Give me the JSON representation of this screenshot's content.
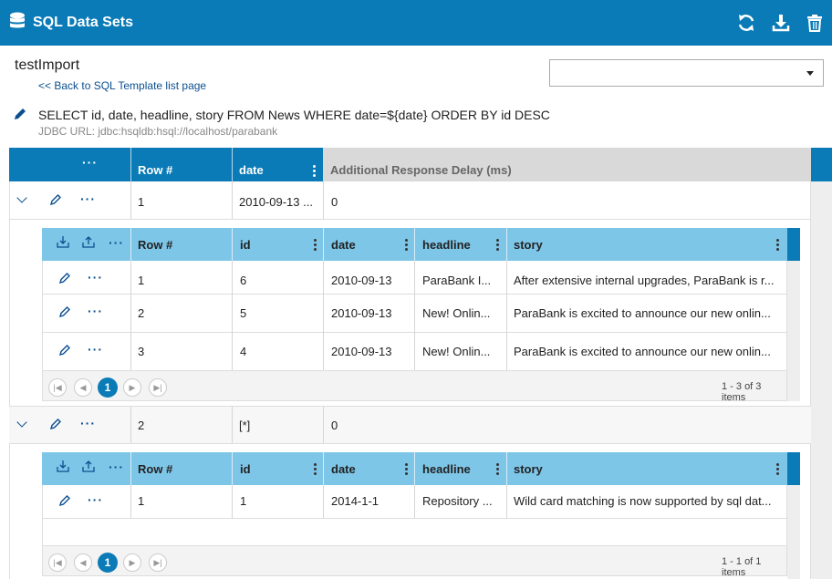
{
  "app": {
    "title": "SQL Data Sets"
  },
  "toolbar": {
    "refresh_icon": "refresh-icon",
    "download_icon": "download-icon",
    "delete_icon": "trash-icon"
  },
  "dataset": {
    "name": "testImport",
    "back_link": "<< Back to SQL Template list page",
    "select_value": "",
    "sql": "SELECT id, date, headline, story FROM News WHERE date=${date} ORDER BY id DESC",
    "jdbc": "JDBC URL: jdbc:hsqldb:hsql://localhost/parabank"
  },
  "outer_table": {
    "menu_label": "···",
    "columns": [
      "Row #",
      "date",
      "Additional Response Delay (ms)"
    ],
    "rows": [
      {
        "row": "1",
        "date": "2010-09-13 ...",
        "delay": "0"
      },
      {
        "row": "2",
        "date": "[*]",
        "delay": "0"
      }
    ]
  },
  "inner_tables": [
    {
      "columns": [
        "Row #",
        "id",
        "date",
        "headline",
        "story"
      ],
      "rows": [
        {
          "row": "1",
          "id": "6",
          "date": "2010-09-13",
          "headline": "ParaBank I...",
          "story": "After extensive internal upgrades, ParaBank is r..."
        },
        {
          "row": "2",
          "id": "5",
          "date": "2010-09-13",
          "headline": "New! Onlin...",
          "story": "ParaBank is excited to announce our new onlin..."
        },
        {
          "row": "3",
          "id": "4",
          "date": "2010-09-13",
          "headline": "New! Onlin...",
          "story": "ParaBank is excited to announce our new onlin..."
        }
      ],
      "pager": {
        "current": "1",
        "info": "1 - 3 of 3 items"
      }
    },
    {
      "columns": [
        "Row #",
        "id",
        "date",
        "headline",
        "story"
      ],
      "rows": [
        {
          "row": "1",
          "id": "1",
          "date": "2014-1-1",
          "headline": "Repository ...",
          "story": "Wild card matching is now supported by sql dat..."
        }
      ],
      "pager": {
        "current": "1",
        "info": "1 - 1 of 1 items"
      }
    }
  ],
  "colors": {
    "primary": "#0a7bb7",
    "inner_header": "#7ec6e8",
    "header_gray": "#d9d9d9"
  }
}
